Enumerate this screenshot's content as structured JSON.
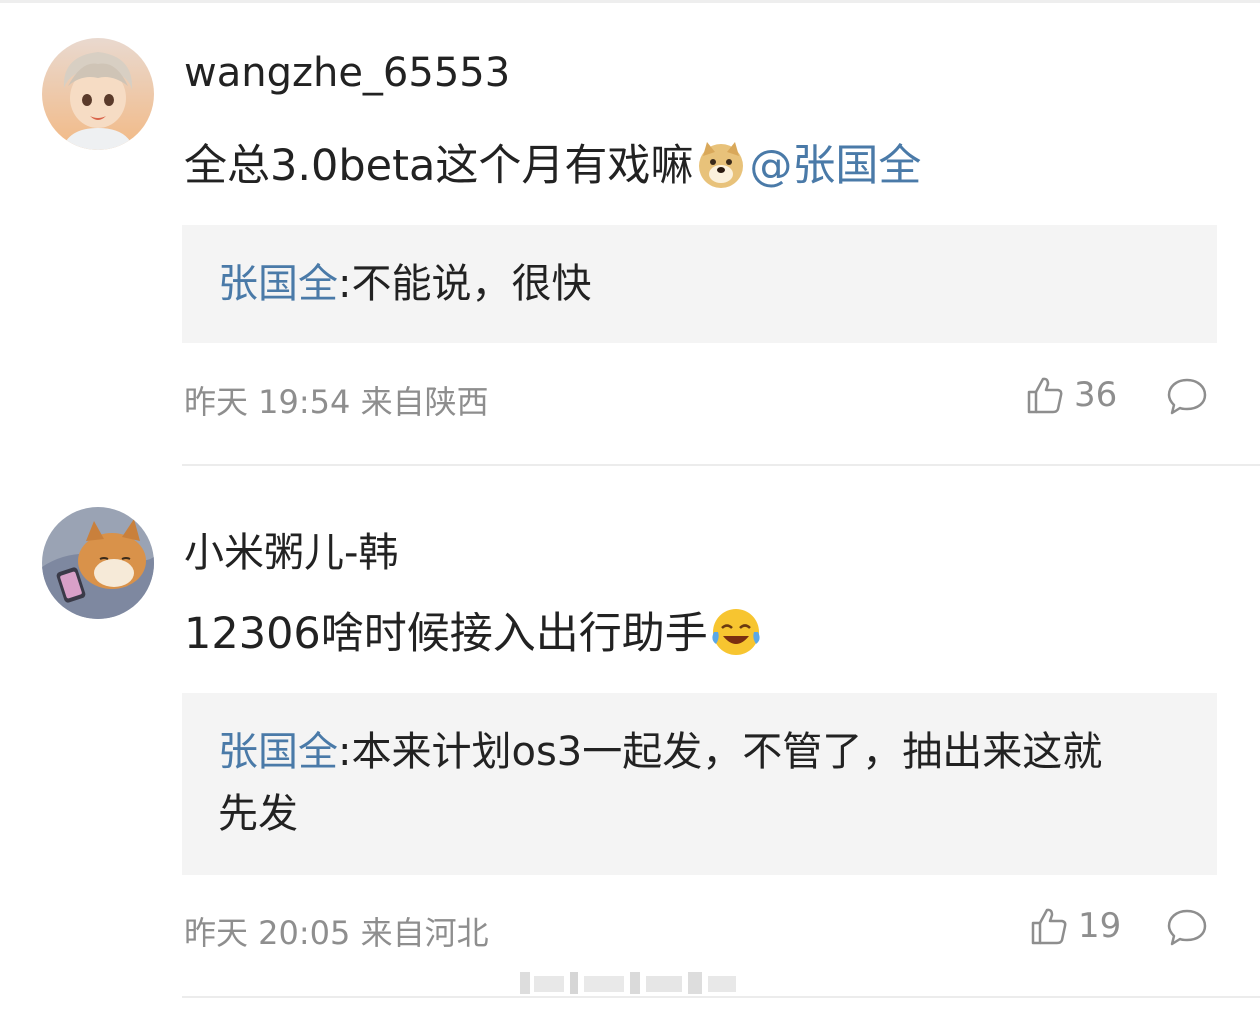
{
  "comments": [
    {
      "username": "wangzhe_65553",
      "text": "全总3.0beta这个月有戏嘛",
      "emoji": "doge-emoji",
      "mention": "@张国全",
      "reply": {
        "author": "张国全",
        "separator": ":",
        "text": "不能说，很快"
      },
      "time": "昨天 19:54",
      "location": "来自陕西",
      "likes": "36"
    },
    {
      "username": "小米粥儿-韩",
      "text": "12306啥时候接入出行助手",
      "emoji": "laugh-cry-emoji",
      "reply": {
        "author": "张国全",
        "separator": ":",
        "text": "本来计划os3一起发，不管了，抽出来这就",
        "text_line2": "先发"
      },
      "time": "昨天 20:05",
      "location": "来自河北",
      "likes": "19"
    }
  ],
  "colors": {
    "link": "#4a7aa8",
    "meta": "#8e8e8e",
    "reply_bg": "#f4f4f4"
  }
}
